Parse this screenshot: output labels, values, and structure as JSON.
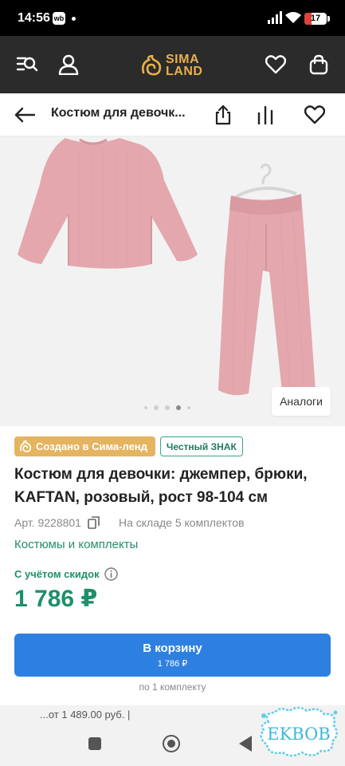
{
  "status_bar": {
    "time": "14:56",
    "notification_icon_text": "wb",
    "battery_level": "17"
  },
  "app_header": {
    "logo_line1": "SIMA",
    "logo_line2": "LAND"
  },
  "toolbar": {
    "title": "Костюм для девочк..."
  },
  "gallery": {
    "analogs_label": "Аналоги",
    "slide_count": 5,
    "active_slide": 4
  },
  "product": {
    "badge_sima": "Создано в Сима-ленд",
    "badge_znak": "Честный ЗНАК",
    "title": "Костюм для девочки: джемпер, брюки, KAFTAN, розовый, рост 98-104 см",
    "article": "Арт. 9228801",
    "stock": "На складе 5 комплектов",
    "category": "Костюмы и комплекты",
    "discount_label": "С учётом скидок",
    "price": "1 786 ₽"
  },
  "cart": {
    "label": "В корзину",
    "price": "1 786 ₽",
    "per_unit": "по 1 комплекту"
  },
  "bottom_strip": {
    "text": "...от 1 489.00 руб. |"
  },
  "watermark": {
    "text": "EKBOB"
  },
  "colors": {
    "header_bg": "#2b2b2b",
    "brand_gold": "#e8b04a",
    "accent_green": "#1f8f6b",
    "cart_blue": "#2e80e0",
    "badge_gold": "#e5b45f",
    "garment_pink": "#e3a7ad"
  },
  "icons": {
    "header_left": [
      "catalog-search-icon",
      "profile-icon"
    ],
    "header_right": [
      "heart-icon",
      "bag-icon"
    ],
    "toolbar": [
      "back-arrow-icon",
      "share-icon",
      "compare-icon",
      "favorite-icon"
    ]
  }
}
